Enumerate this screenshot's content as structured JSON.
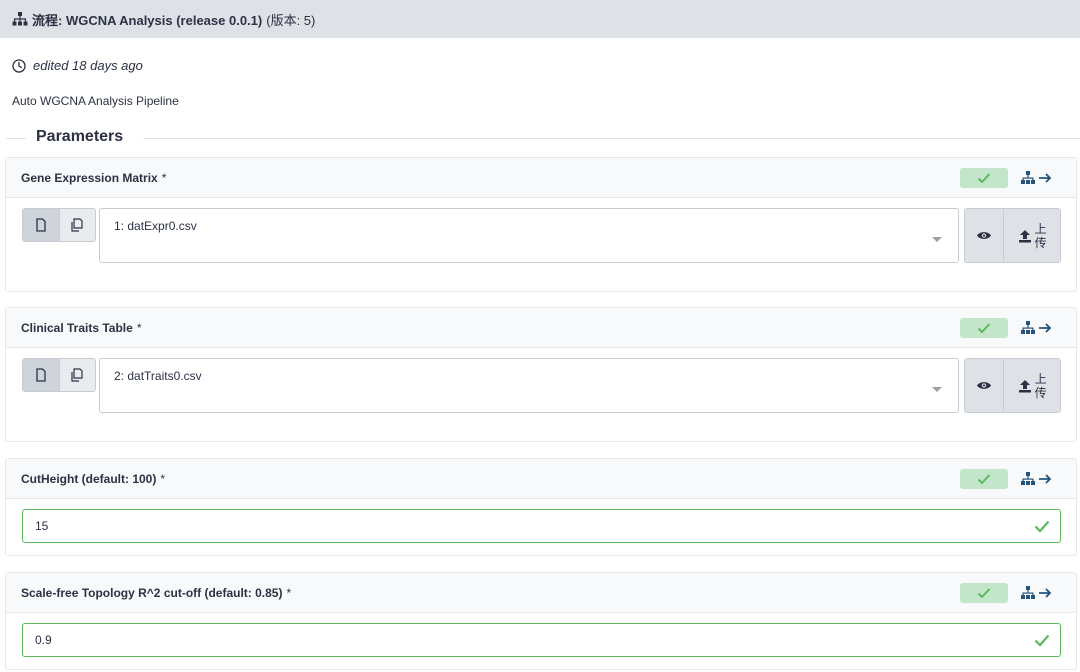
{
  "header": {
    "title_prefix": "流程: WGCNA Analysis (release 0.0.1)",
    "version_text": "(版本: 5)"
  },
  "meta": {
    "edited": "edited 18 days ago"
  },
  "annotation": "Auto WGCNA Analysis Pipeline",
  "params_heading": "Parameters",
  "inputs": [
    {
      "label": "Gene Expression Matrix",
      "required": "*",
      "selected": "1: datExpr0.csv",
      "upload_line1": "上",
      "upload_line2": "传"
    },
    {
      "label": "Clinical Traits Table",
      "required": "*",
      "selected": "2: datTraits0.csv",
      "upload_line1": "上",
      "upload_line2": "传"
    },
    {
      "label": "CutHeight (default: 100)",
      "required": "*",
      "value": "15"
    },
    {
      "label": "Scale-free Topology R^2 cut-off (default: 0.85)",
      "required": "*",
      "value": "0.9"
    }
  ],
  "colors": {
    "header_bg": "#dee2e6",
    "valid_green": "#5cb85c",
    "badge_green": "#c3e6cb",
    "connection_blue": "#25537b"
  },
  "icons": [
    "sitemap-icon",
    "clock-icon",
    "file-icon",
    "files-icon",
    "eye-icon",
    "upload-icon",
    "check-icon",
    "connection-arrow-icon"
  ]
}
